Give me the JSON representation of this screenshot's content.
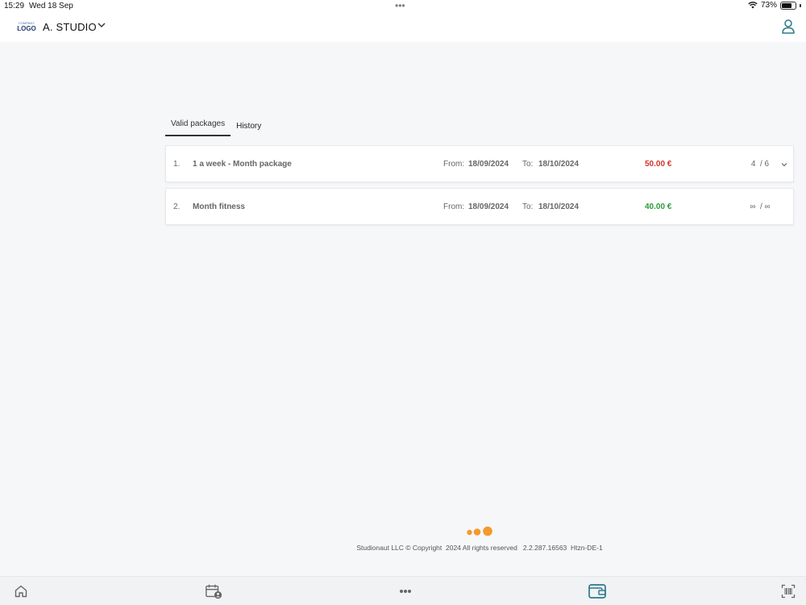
{
  "status_bar": {
    "time": "15:29",
    "date": "Wed 18 Sep",
    "battery": "73%",
    "battery_level": 0.73
  },
  "header": {
    "logo_small": "COMPANY",
    "logo_big": "LOGO",
    "studio_name": "A. STUDIO",
    "icons": [
      "chevron-down-icon",
      "user-icon"
    ]
  },
  "tabs": [
    {
      "label": "Valid packages",
      "active": true
    },
    {
      "label": "History",
      "active": false
    }
  ],
  "packages": [
    {
      "index": "1.",
      "name": "1 a week - Month package",
      "from_label": "From:",
      "from": "18/09/2024",
      "to_label": "To:",
      "to": "18/10/2024",
      "price": "50.00 €",
      "price_color": "#d0342c",
      "usage": "4  / 6",
      "expandable": true
    },
    {
      "index": "2.",
      "name": "Month fitness",
      "from_label": "From:",
      "from": "18/09/2024",
      "to_label": "To:",
      "to": "18/10/2024",
      "price": "40.00 €",
      "price_color": "#2e9a3a",
      "usage": "∞  / ∞",
      "expandable": false
    }
  ],
  "footer": {
    "copyright": "Studionaut LLC © Copyright  2024 All rights reserved   2.2.287.16563  Htzn-DE-1",
    "loader_color": "#f39a2b"
  },
  "bottom_nav": {
    "items": [
      "home-icon",
      "calendar-user-icon",
      "more-icon",
      "wallet-icon",
      "barcode-scan-icon"
    ],
    "active": "wallet-icon",
    "active_color": "#2a7a8c",
    "inactive_color": "#666666"
  }
}
